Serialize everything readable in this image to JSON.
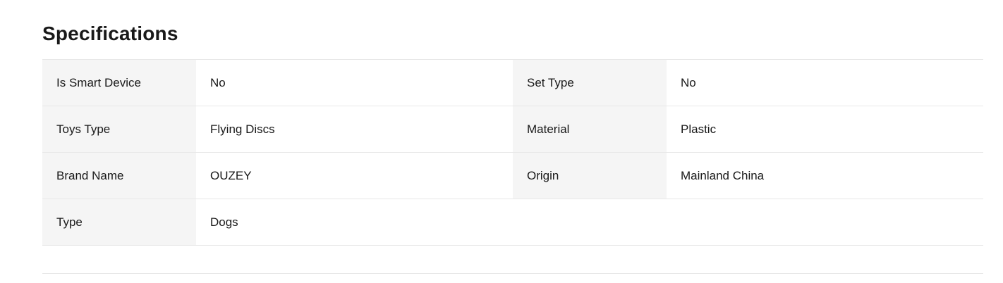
{
  "section": {
    "title": "Specifications"
  },
  "specs": [
    [
      {
        "label": "Is Smart Device",
        "value": "No"
      },
      {
        "label": "Set Type",
        "value": "No"
      }
    ],
    [
      {
        "label": "Toys Type",
        "value": "Flying Discs"
      },
      {
        "label": "Material",
        "value": "Plastic"
      }
    ],
    [
      {
        "label": "Brand Name",
        "value": "OUZEY"
      },
      {
        "label": "Origin",
        "value": "Mainland China"
      }
    ],
    [
      {
        "label": "Type",
        "value": "Dogs"
      },
      {
        "label": "",
        "value": ""
      }
    ]
  ]
}
